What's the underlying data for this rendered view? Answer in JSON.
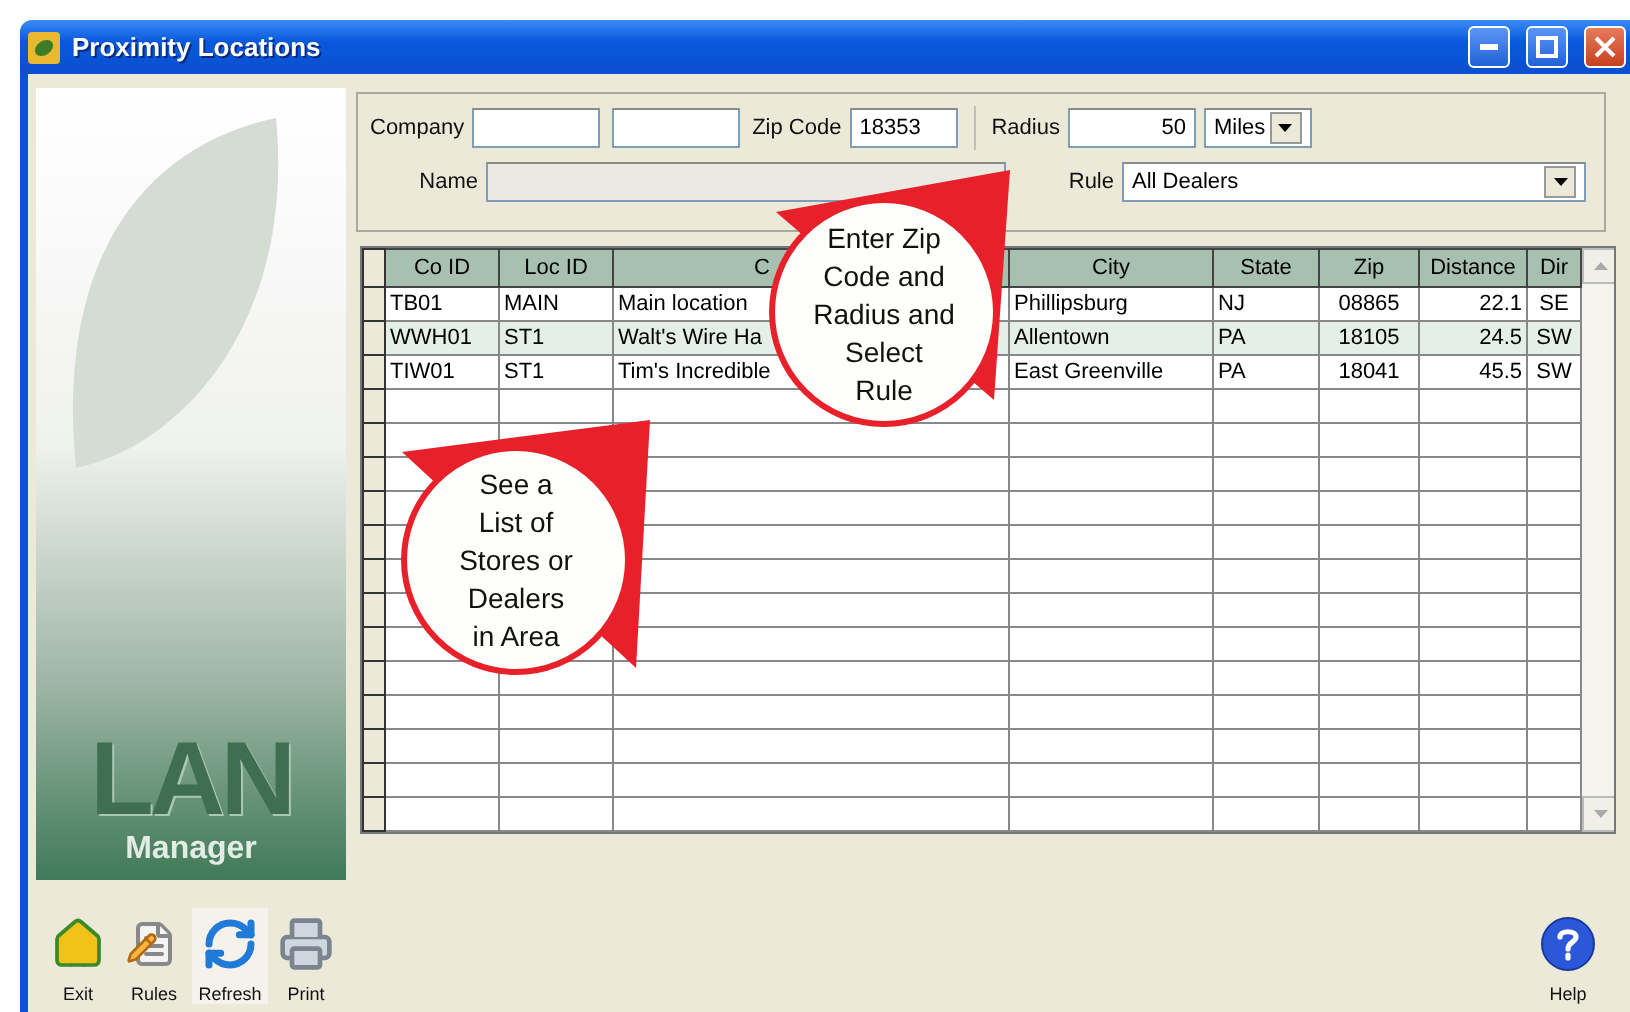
{
  "window": {
    "title": "Proximity Locations"
  },
  "sidebar": {
    "logo_text": "LAN",
    "caption": "Manager"
  },
  "filters": {
    "company_label": "Company",
    "zip_label": "Zip Code",
    "zip_value": "18353",
    "radius_label": "Radius",
    "radius_value": "50",
    "unit": "Miles",
    "name_label": "Name",
    "rule_label": "Rule",
    "rule_value": "All Dealers"
  },
  "table": {
    "columns": [
      "Co ID",
      "Loc ID",
      "C",
      "City",
      "State",
      "Zip",
      "Distance",
      "Dir"
    ],
    "rows": [
      {
        "selected": false,
        "cells": [
          "TB01",
          "MAIN",
          "Main location",
          "Phillipsburg",
          "NJ",
          "08865",
          "22.1",
          "SE"
        ]
      },
      {
        "selected": true,
        "cells": [
          "WWH01",
          "ST1",
          "Walt's Wire Ha",
          "Allentown",
          "PA",
          "18105",
          "24.5",
          "SW"
        ]
      },
      {
        "selected": false,
        "cells": [
          "TIW01",
          "ST1",
          "Tim's Incredible",
          "East Greenville",
          "PA",
          "18041",
          "45.5",
          "SW"
        ]
      }
    ]
  },
  "callouts": [
    {
      "lines": [
        "Enter Zip",
        "Code and",
        "Radius and",
        "Select",
        "Rule"
      ]
    },
    {
      "lines": [
        "See a",
        "List of",
        "Stores or",
        "Dealers",
        "in Area"
      ]
    }
  ],
  "toolbar": [
    {
      "kind": "exit",
      "label": "Exit"
    },
    {
      "kind": "rules",
      "label": "Rules"
    },
    {
      "kind": "refresh",
      "label": "Refresh"
    },
    {
      "kind": "print",
      "label": "Print"
    }
  ],
  "help": {
    "label": "Help"
  }
}
